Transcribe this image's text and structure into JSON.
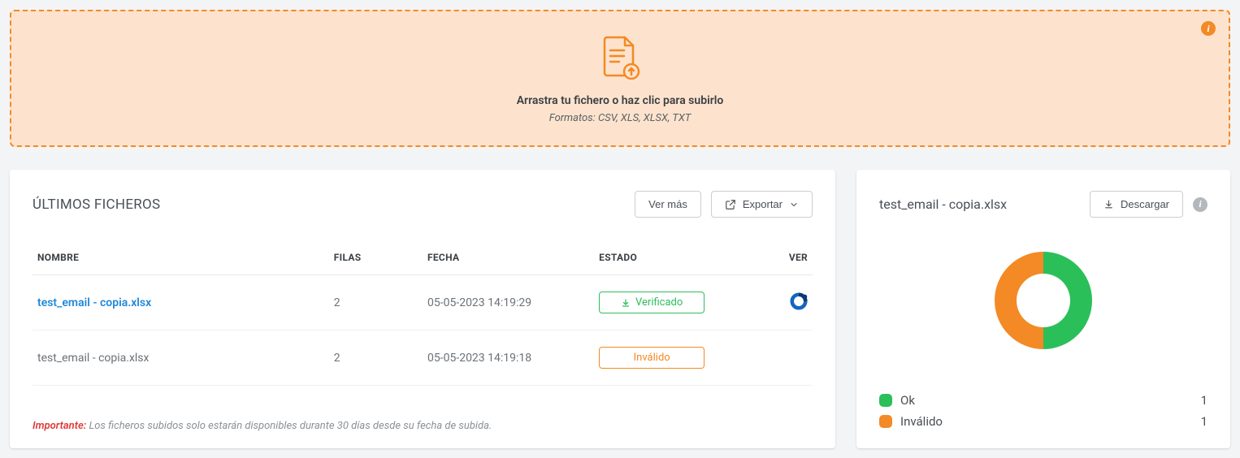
{
  "dropzone": {
    "title": "Arrastra tu fichero o haz clic para subirlo",
    "subtitle": "Formatos: CSV, XLS, XLSX, TXT"
  },
  "files_panel": {
    "title": "ÚLTIMOS FICHEROS",
    "ver_mas_label": "Ver más",
    "exportar_label": "Exportar",
    "headers": {
      "nombre": "NOMBRE",
      "filas": "FILAS",
      "fecha": "FECHA",
      "estado": "ESTADO",
      "ver": "VER"
    },
    "rows": [
      {
        "name": "test_email - copia.xlsx",
        "rows": "2",
        "date": "05-05-2023 14:19:29",
        "status_label": "Verificado",
        "status_kind": "verified",
        "active": true
      },
      {
        "name": "test_email - copia.xlsx",
        "rows": "2",
        "date": "05-05-2023 14:19:18",
        "status_label": "Inválido",
        "status_kind": "invalid",
        "active": false
      }
    ],
    "footnote_important": "Importante:",
    "footnote_text": " Los ficheros subidos solo estarán disponibles durante 30 días desde su fecha de subida."
  },
  "detail_panel": {
    "title": "test_email - copia.xlsx",
    "download_label": "Descargar",
    "legend": [
      {
        "label": "Ok",
        "value": "1",
        "color": "green"
      },
      {
        "label": "Inválido",
        "value": "1",
        "color": "orange"
      }
    ]
  },
  "chart_data": {
    "type": "pie",
    "title": "test_email - copia.xlsx",
    "categories": [
      "Ok",
      "Inválido"
    ],
    "values": [
      1,
      1
    ],
    "colors": [
      "#2bbf5a",
      "#f38a25"
    ],
    "donut": true
  }
}
